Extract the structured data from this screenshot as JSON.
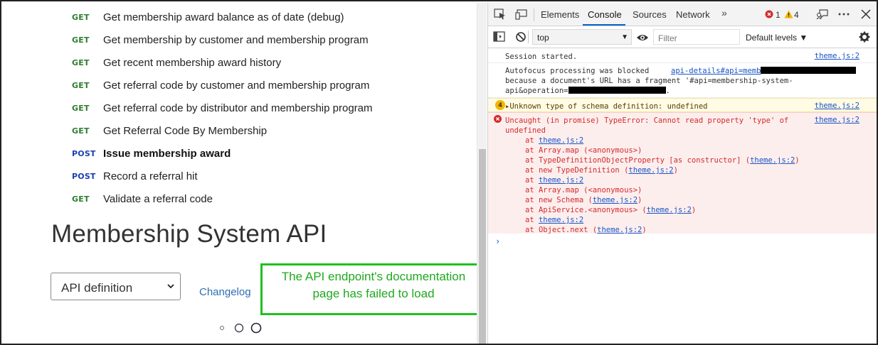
{
  "operations": [
    {
      "method": "GET",
      "name": "Get membership award balance as of date (debug)",
      "active": false
    },
    {
      "method": "GET",
      "name": "Get membership by customer and membership program",
      "active": false
    },
    {
      "method": "GET",
      "name": "Get recent membership award history",
      "active": false
    },
    {
      "method": "GET",
      "name": "Get referral code by customer and membership program",
      "active": false
    },
    {
      "method": "GET",
      "name": "Get referral code by distributor and membership program",
      "active": false
    },
    {
      "method": "GET",
      "name": "Get Referral Code By Membership",
      "active": false
    },
    {
      "method": "POST",
      "name": "Issue membership award",
      "active": true
    },
    {
      "method": "POST",
      "name": "Record a referral hit",
      "active": false
    },
    {
      "method": "GET",
      "name": "Validate a referral code",
      "active": false
    }
  ],
  "api_title": "Membership System API",
  "definition_select": {
    "value": "API definition"
  },
  "changelog_label": "Changelog",
  "callout": {
    "line1": "The API endpoint's documentation",
    "line2": "page has failed to load"
  },
  "devtools": {
    "tabs": [
      "Elements",
      "Console",
      "Sources",
      "Network"
    ],
    "selected_tab": "Console",
    "more_tabs": "»",
    "error_count": "1",
    "warning_count": "4",
    "context": "top",
    "filter_placeholder": "Filter",
    "levels_label": "Default levels ▼",
    "messages": {
      "session": {
        "text": "Session started.",
        "source": "theme.js:2"
      },
      "autofocus": {
        "line1": "Autofocus processing was blocked",
        "link": "api-details#api=memb",
        "line2": "because a document's URL has a fragment '#api=membership-system-",
        "line3": "api&operation=",
        "line3_end": "."
      },
      "warning": {
        "badge": "4",
        "text": "▸Unknown type of schema definition: undefined",
        "source": "theme.js:2"
      },
      "error": {
        "line1": "Uncaught (in promise) TypeError: Cannot read property 'type' of",
        "line2": "undefined",
        "source": "theme.js:2",
        "trace": [
          {
            "pre": "at ",
            "link": "theme.js:2",
            "post": ""
          },
          {
            "pre": "at Array.map (<anonymous>)",
            "link": "",
            "post": ""
          },
          {
            "pre": "at TypeDefinitionObjectProperty [as constructor] (",
            "link": "theme.js:2",
            "post": ")"
          },
          {
            "pre": "at new TypeDefinition (",
            "link": "theme.js:2",
            "post": ")"
          },
          {
            "pre": "at ",
            "link": "theme.js:2",
            "post": ""
          },
          {
            "pre": "at Array.map (<anonymous>)",
            "link": "",
            "post": ""
          },
          {
            "pre": "at new Schema (",
            "link": "theme.js:2",
            "post": ")"
          },
          {
            "pre": "at ApiService.<anonymous> (",
            "link": "theme.js:2",
            "post": ")"
          },
          {
            "pre": "at ",
            "link": "theme.js:2",
            "post": ""
          },
          {
            "pre": "at Object.next (",
            "link": "theme.js:2",
            "post": ")"
          }
        ]
      },
      "prompt": "›"
    }
  },
  "colors": {
    "get": "#2e7d32",
    "post": "#1a3fb0",
    "callout": "#20c020",
    "error": "#d32b2b",
    "link": "#1a55c5"
  }
}
